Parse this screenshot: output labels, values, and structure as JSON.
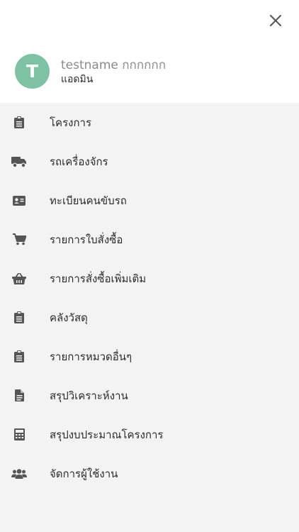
{
  "header": {
    "avatar_letter": "T",
    "user_name": "testname กกกกกก",
    "user_role": "แอดมิน"
  },
  "menu": {
    "items": [
      {
        "label": "โครงการ",
        "icon": "clipboard-icon"
      },
      {
        "label": "รถเครื่องจักร",
        "icon": "truck-icon"
      },
      {
        "label": "ทะเบียนคนขับรถ",
        "icon": "id-card-icon"
      },
      {
        "label": "รายการใบสั่งซื้อ",
        "icon": "shopping-cart-icon"
      },
      {
        "label": "รายการสั่งซื้อเพิ่มเติม",
        "icon": "basket-icon"
      },
      {
        "label": "คลังวัสดุ",
        "icon": "clipboard-icon"
      },
      {
        "label": "รายการหมวดอื่นๆ",
        "icon": "clipboard-icon"
      },
      {
        "label": "สรุปวิเคราะห์งาน",
        "icon": "document-icon"
      },
      {
        "label": "สรุปงบประมาณโครงการ",
        "icon": "calculator-icon"
      },
      {
        "label": "จัดการผู้ใช้งาน",
        "icon": "users-icon"
      }
    ]
  },
  "colors": {
    "avatar_bg": "#7ec2a4",
    "icon": "#555555",
    "menu_bg": "#f3f3f3",
    "header_bg": "#ffffff"
  }
}
